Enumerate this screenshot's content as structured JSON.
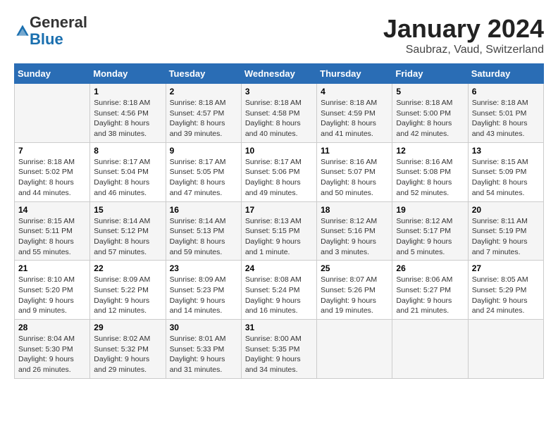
{
  "logo": {
    "general": "General",
    "blue": "Blue"
  },
  "title": "January 2024",
  "subtitle": "Saubraz, Vaud, Switzerland",
  "days_of_week": [
    "Sunday",
    "Monday",
    "Tuesday",
    "Wednesday",
    "Thursday",
    "Friday",
    "Saturday"
  ],
  "weeks": [
    [
      {
        "day": "",
        "info": ""
      },
      {
        "day": "1",
        "info": "Sunrise: 8:18 AM\nSunset: 4:56 PM\nDaylight: 8 hours\nand 38 minutes."
      },
      {
        "day": "2",
        "info": "Sunrise: 8:18 AM\nSunset: 4:57 PM\nDaylight: 8 hours\nand 39 minutes."
      },
      {
        "day": "3",
        "info": "Sunrise: 8:18 AM\nSunset: 4:58 PM\nDaylight: 8 hours\nand 40 minutes."
      },
      {
        "day": "4",
        "info": "Sunrise: 8:18 AM\nSunset: 4:59 PM\nDaylight: 8 hours\nand 41 minutes."
      },
      {
        "day": "5",
        "info": "Sunrise: 8:18 AM\nSunset: 5:00 PM\nDaylight: 8 hours\nand 42 minutes."
      },
      {
        "day": "6",
        "info": "Sunrise: 8:18 AM\nSunset: 5:01 PM\nDaylight: 8 hours\nand 43 minutes."
      }
    ],
    [
      {
        "day": "7",
        "info": "Sunrise: 8:18 AM\nSunset: 5:02 PM\nDaylight: 8 hours\nand 44 minutes."
      },
      {
        "day": "8",
        "info": "Sunrise: 8:17 AM\nSunset: 5:04 PM\nDaylight: 8 hours\nand 46 minutes."
      },
      {
        "day": "9",
        "info": "Sunrise: 8:17 AM\nSunset: 5:05 PM\nDaylight: 8 hours\nand 47 minutes."
      },
      {
        "day": "10",
        "info": "Sunrise: 8:17 AM\nSunset: 5:06 PM\nDaylight: 8 hours\nand 49 minutes."
      },
      {
        "day": "11",
        "info": "Sunrise: 8:16 AM\nSunset: 5:07 PM\nDaylight: 8 hours\nand 50 minutes."
      },
      {
        "day": "12",
        "info": "Sunrise: 8:16 AM\nSunset: 5:08 PM\nDaylight: 8 hours\nand 52 minutes."
      },
      {
        "day": "13",
        "info": "Sunrise: 8:15 AM\nSunset: 5:09 PM\nDaylight: 8 hours\nand 54 minutes."
      }
    ],
    [
      {
        "day": "14",
        "info": "Sunrise: 8:15 AM\nSunset: 5:11 PM\nDaylight: 8 hours\nand 55 minutes."
      },
      {
        "day": "15",
        "info": "Sunrise: 8:14 AM\nSunset: 5:12 PM\nDaylight: 8 hours\nand 57 minutes."
      },
      {
        "day": "16",
        "info": "Sunrise: 8:14 AM\nSunset: 5:13 PM\nDaylight: 8 hours\nand 59 minutes."
      },
      {
        "day": "17",
        "info": "Sunrise: 8:13 AM\nSunset: 5:15 PM\nDaylight: 9 hours\nand 1 minute."
      },
      {
        "day": "18",
        "info": "Sunrise: 8:12 AM\nSunset: 5:16 PM\nDaylight: 9 hours\nand 3 minutes."
      },
      {
        "day": "19",
        "info": "Sunrise: 8:12 AM\nSunset: 5:17 PM\nDaylight: 9 hours\nand 5 minutes."
      },
      {
        "day": "20",
        "info": "Sunrise: 8:11 AM\nSunset: 5:19 PM\nDaylight: 9 hours\nand 7 minutes."
      }
    ],
    [
      {
        "day": "21",
        "info": "Sunrise: 8:10 AM\nSunset: 5:20 PM\nDaylight: 9 hours\nand 9 minutes."
      },
      {
        "day": "22",
        "info": "Sunrise: 8:09 AM\nSunset: 5:22 PM\nDaylight: 9 hours\nand 12 minutes."
      },
      {
        "day": "23",
        "info": "Sunrise: 8:09 AM\nSunset: 5:23 PM\nDaylight: 9 hours\nand 14 minutes."
      },
      {
        "day": "24",
        "info": "Sunrise: 8:08 AM\nSunset: 5:24 PM\nDaylight: 9 hours\nand 16 minutes."
      },
      {
        "day": "25",
        "info": "Sunrise: 8:07 AM\nSunset: 5:26 PM\nDaylight: 9 hours\nand 19 minutes."
      },
      {
        "day": "26",
        "info": "Sunrise: 8:06 AM\nSunset: 5:27 PM\nDaylight: 9 hours\nand 21 minutes."
      },
      {
        "day": "27",
        "info": "Sunrise: 8:05 AM\nSunset: 5:29 PM\nDaylight: 9 hours\nand 24 minutes."
      }
    ],
    [
      {
        "day": "28",
        "info": "Sunrise: 8:04 AM\nSunset: 5:30 PM\nDaylight: 9 hours\nand 26 minutes."
      },
      {
        "day": "29",
        "info": "Sunrise: 8:02 AM\nSunset: 5:32 PM\nDaylight: 9 hours\nand 29 minutes."
      },
      {
        "day": "30",
        "info": "Sunrise: 8:01 AM\nSunset: 5:33 PM\nDaylight: 9 hours\nand 31 minutes."
      },
      {
        "day": "31",
        "info": "Sunrise: 8:00 AM\nSunset: 5:35 PM\nDaylight: 9 hours\nand 34 minutes."
      },
      {
        "day": "",
        "info": ""
      },
      {
        "day": "",
        "info": ""
      },
      {
        "day": "",
        "info": ""
      }
    ]
  ]
}
